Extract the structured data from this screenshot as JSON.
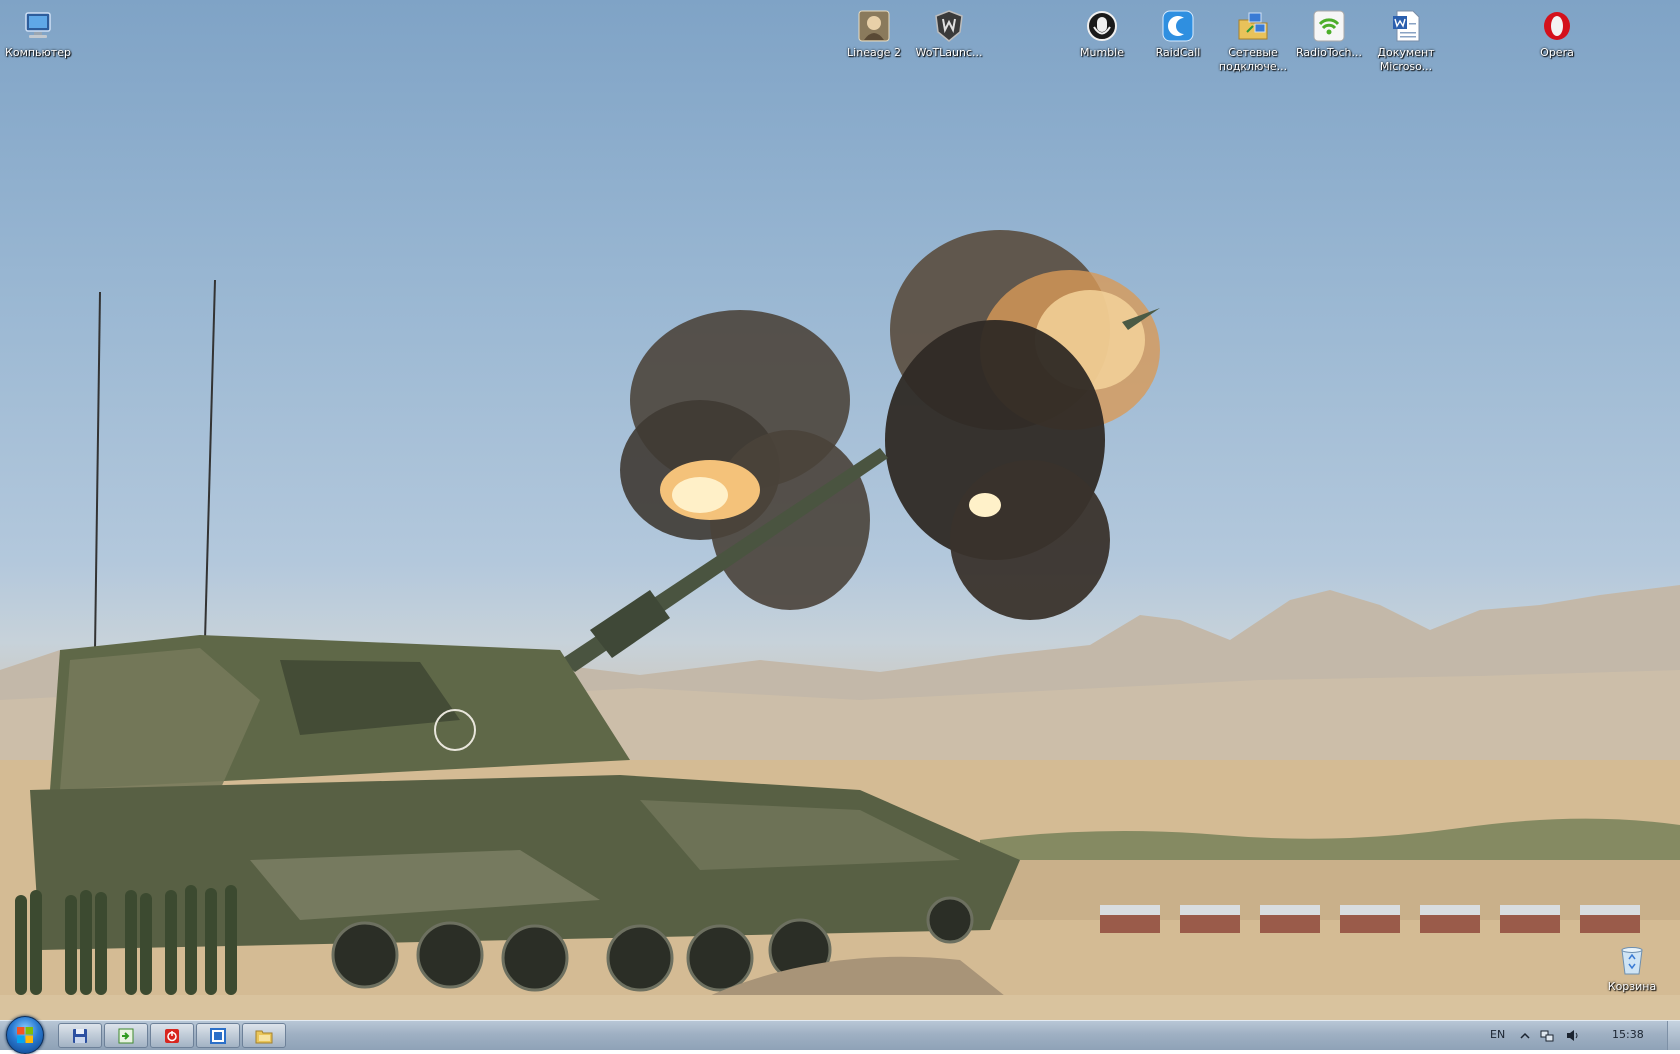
{
  "desktop": {
    "icons": [
      {
        "label": "Компьютер",
        "icon": "computer-icon"
      },
      {
        "label": "Lineage 2",
        "icon": "lineage2-icon"
      },
      {
        "label": "WoTLaunc...",
        "icon": "wot-launcher-icon"
      },
      {
        "label": "Mumble",
        "icon": "mumble-icon"
      },
      {
        "label": "RaidCall",
        "icon": "raidcall-icon"
      },
      {
        "label": "Сетевые\nподключе...",
        "icon": "network-connections-icon"
      },
      {
        "label": "RadioToch...",
        "icon": "radiotochka-icon"
      },
      {
        "label": "Документ\nMicroso...",
        "icon": "word-document-icon"
      },
      {
        "label": "Opera",
        "icon": "opera-icon"
      },
      {
        "label": "Корзина",
        "icon": "recycle-bin-icon"
      }
    ]
  },
  "taskbar": {
    "pinned": [
      {
        "icon": "save-disk-icon"
      },
      {
        "icon": "green-arrow-app-icon"
      },
      {
        "icon": "red-power-app-icon"
      },
      {
        "icon": "blue-window-app-icon"
      },
      {
        "icon": "explorer-folder-icon"
      }
    ],
    "tray": {
      "language": "EN",
      "clock": "15:38",
      "icons": [
        "show-hidden-icons-chevron",
        "network-icon",
        "volume-icon"
      ]
    }
  },
  "colors": {
    "taskbar": "#9fb0c3",
    "desktop_text": "#ffffff",
    "sky": "#8fb0cf",
    "sand": "#d0b890"
  }
}
